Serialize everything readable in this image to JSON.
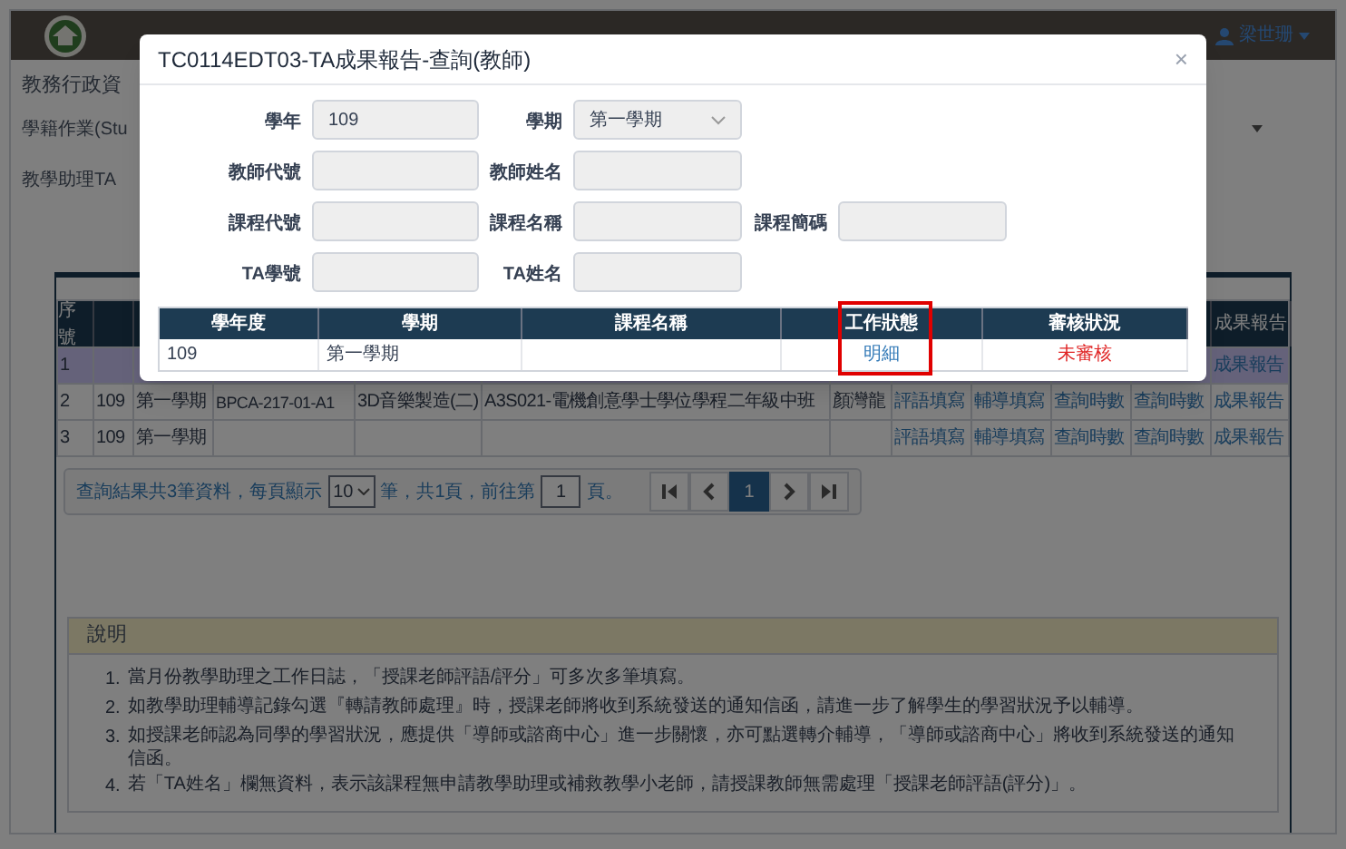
{
  "navbar": {
    "user": "梁世珊"
  },
  "page": {
    "title": "教務行政資",
    "menu": [
      "學籍作業(Stu",
      "教學助理TA"
    ]
  },
  "results_table": {
    "columns": [
      "序號",
      null,
      null,
      null,
      null,
      null,
      null,
      null,
      null,
      null,
      null,
      "成果報告"
    ],
    "rows": [
      {
        "selected": true,
        "cells": [
          {
            "text": "1",
            "kind": "text"
          },
          null,
          null,
          null,
          null,
          null,
          null,
          null,
          null,
          null,
          null,
          {
            "text": "成果報告",
            "kind": "link"
          }
        ]
      },
      {
        "selected": false,
        "cells": [
          {
            "text": "2",
            "kind": "text"
          },
          {
            "text": "109",
            "kind": "text"
          },
          {
            "text": "第一學期",
            "kind": "text"
          },
          {
            "text": "BPCA-217-01-A1",
            "kind": "text"
          },
          {
            "text": "3D音樂製造(二)",
            "kind": "text"
          },
          {
            "text": "A3S021-電機創意學士學位學程二年級中班",
            "kind": "text"
          },
          {
            "text": "顏灣龍",
            "kind": "text"
          },
          {
            "text": "評語填寫",
            "kind": "link"
          },
          {
            "text": "輔導填寫",
            "kind": "link"
          },
          {
            "text": "查詢時數",
            "kind": "link"
          },
          {
            "text": "查詢時數",
            "kind": "link"
          },
          {
            "text": "成果報告",
            "kind": "link"
          }
        ]
      },
      {
        "selected": false,
        "cells": [
          {
            "text": "3",
            "kind": "text"
          },
          {
            "text": "109",
            "kind": "text"
          },
          {
            "text": "第一學期",
            "kind": "text"
          },
          null,
          null,
          null,
          null,
          {
            "text": "評語填寫",
            "kind": "link"
          },
          {
            "text": "輔導填寫",
            "kind": "link"
          },
          {
            "text": "查詢時數",
            "kind": "link"
          },
          {
            "text": "查詢時數",
            "kind": "link"
          },
          {
            "text": "成果報告",
            "kind": "link"
          }
        ]
      }
    ]
  },
  "pagination": {
    "summary_before": "查詢結果共3筆資料，每頁顯示",
    "page_size": "10",
    "summary_middle": "筆，共1頁，前往第",
    "goto_page": "1",
    "summary_after": "頁。",
    "pages": [
      {
        "label": "1",
        "selected": true
      }
    ]
  },
  "notes": {
    "title": "說明",
    "items": [
      {
        "number": "1.",
        "text": "當月份教學助理之工作日誌，「授課老師評語/評分」可多次多筆填寫。"
      },
      {
        "number": "2.",
        "text": "如教學助理輔導記錄勾選『轉請教師處理』時，授課老師將收到系統發送的通知信函，請進一步了解學生的學習狀況予以輔導。"
      },
      {
        "number": "3.",
        "text": "如授課老師認為同學的學習狀況，應提供「導師或諮商中心」進一步關懷，亦可點選轉介輔導，「導師或諮商中心」將收到系統發送的通知信函。"
      },
      {
        "number": "4.",
        "text": "若「TA姓名」欄無資料，表示該課程無申請教學助理或補救教學小老師，請授課教師無需處理「授課老師評語(評分)」。"
      }
    ]
  },
  "dialog": {
    "title": "TC0114EDT03-TA成果報告-查詢(教師)",
    "close": "×",
    "fields": [
      [
        {
          "label": "學年",
          "kind": "input",
          "value": "109"
        },
        {
          "label": "學期",
          "kind": "select",
          "value": "第一學期"
        }
      ],
      [
        {
          "label": "教師代號",
          "kind": "input"
        },
        {
          "label": "教師姓名",
          "kind": "input"
        }
      ],
      [
        {
          "label": "課程代號",
          "kind": "input"
        },
        {
          "label": "課程名稱",
          "kind": "input"
        },
        {
          "label": "課程簡碼",
          "kind": "input"
        }
      ],
      [
        {
          "label": "TA學號",
          "kind": "input"
        },
        {
          "label": "TA姓名",
          "kind": "input"
        }
      ]
    ],
    "table": {
      "columns": [
        {
          "label": "學年度",
          "highlighted": false
        },
        {
          "label": "學期",
          "highlighted": false
        },
        {
          "label": "課程名稱",
          "highlighted": false
        },
        {
          "label": "工作狀態",
          "highlighted": true
        },
        {
          "label": "審核狀況",
          "highlighted": false
        }
      ],
      "rows": [
        [
          {
            "text": "109",
            "kind": "text"
          },
          {
            "text": "第一學期",
            "kind": "text"
          },
          null,
          {
            "text": "明細",
            "kind": "link"
          },
          {
            "text": "未審核",
            "kind": "alert"
          }
        ]
      ]
    }
  }
}
